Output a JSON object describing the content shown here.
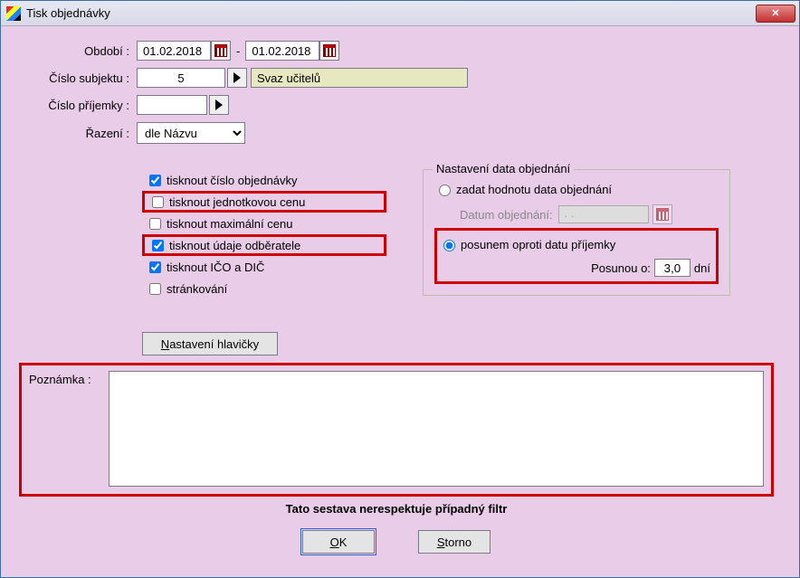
{
  "window": {
    "title": "Tisk objednávky"
  },
  "labels": {
    "obdobi": "Období :",
    "cislo_subjektu": "Číslo subjektu :",
    "cislo_prijemky": "Číslo příjemky :",
    "razeni": "Řazení :",
    "poznamka": "Poznámka :"
  },
  "period": {
    "from": "01.02.2018",
    "to": "01.02.2018",
    "dash": "-"
  },
  "subject": {
    "number": "5",
    "name": "Svaz učitelů"
  },
  "receipt": {
    "number": ""
  },
  "sort": {
    "selected": "dle Názvu",
    "options": [
      "dle Názvu"
    ]
  },
  "checks": {
    "cislo_obj": {
      "label": "tisknout číslo objednávky",
      "checked": true
    },
    "jedn_cenu": {
      "label": "tisknout jednotkovou cenu",
      "checked": false
    },
    "max_cenu": {
      "label": "tisknout maximální cenu",
      "checked": false
    },
    "odberatele": {
      "label": "tisknout údaje odběratele",
      "checked": true
    },
    "ico_dic": {
      "label": "tisknout IČO a DIČ",
      "checked": true
    },
    "strankovani": {
      "label": "stránkování",
      "checked": false
    }
  },
  "ordering_date": {
    "legend": "Nastavení data objednání",
    "opt_zadat": "zadat hodnotu data objednání",
    "datum_label": "Datum objednání:",
    "datum_value": ". .",
    "opt_posun": "posunem oproti datu příjemky",
    "posun_label": "Posunou o:",
    "posun_value": "3,0",
    "posun_unit": "dní",
    "selected": "posun"
  },
  "header_btn": "Nastavení hlavičky",
  "note_text": "",
  "footer_note": "Tato sestava nerespektuje případný filtr",
  "buttons": {
    "ok": "OK",
    "cancel": "Storno"
  }
}
